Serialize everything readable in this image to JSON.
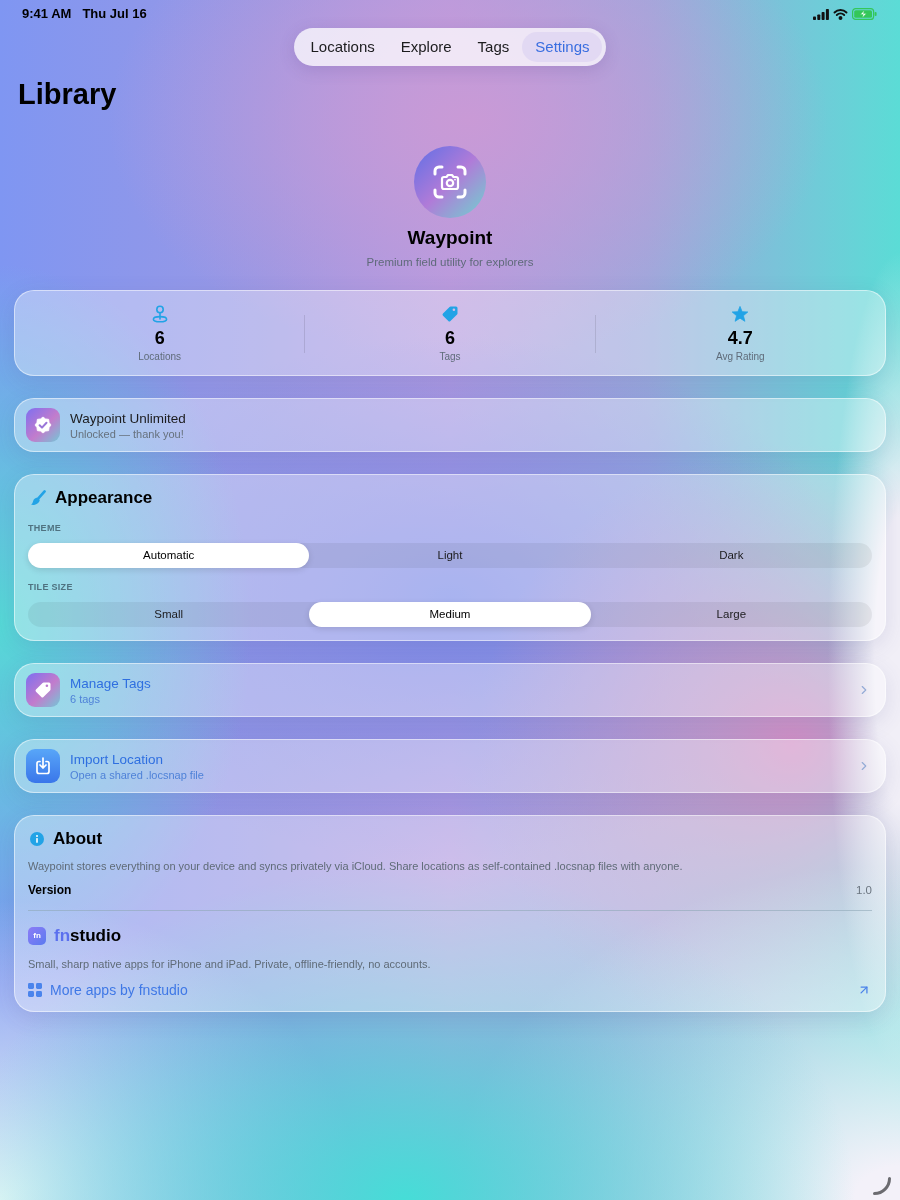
{
  "status_bar": {
    "time": "9:41 AM",
    "date": "Thu Jul 16"
  },
  "tabs": [
    {
      "label": "Locations",
      "selected": false
    },
    {
      "label": "Explore",
      "selected": false
    },
    {
      "label": "Tags",
      "selected": false
    },
    {
      "label": "Settings",
      "selected": true
    }
  ],
  "page_title": "Library",
  "app": {
    "name": "Waypoint",
    "tagline": "Premium field utility for explorers"
  },
  "stats": [
    {
      "kind": "pin",
      "value": "6",
      "label": "Locations"
    },
    {
      "kind": "tag",
      "value": "6",
      "label": "Tags"
    },
    {
      "kind": "star",
      "value": "4.7",
      "label": "Avg Rating"
    }
  ],
  "unlimited": {
    "title": "Waypoint Unlimited",
    "subtitle": "Unlocked — thank you!"
  },
  "appearance": {
    "title": "Appearance",
    "groups": [
      {
        "label": "THEME",
        "options": [
          {
            "label": "Automatic",
            "selected": true
          },
          {
            "label": "Light",
            "selected": false
          },
          {
            "label": "Dark",
            "selected": false
          }
        ]
      },
      {
        "label": "TILE SIZE",
        "options": [
          {
            "label": "Small",
            "selected": false
          },
          {
            "label": "Medium",
            "selected": true
          },
          {
            "label": "Large",
            "selected": false
          }
        ]
      }
    ]
  },
  "actions": [
    {
      "kind": "tags",
      "title": "Manage Tags",
      "subtitle": "6 tags"
    },
    {
      "kind": "import",
      "title": "Import Location",
      "subtitle": "Open a shared .locsnap file"
    }
  ],
  "about": {
    "title": "About",
    "description": "Waypoint stores everything on your device and syncs privately via iCloud. Share locations as self-contained .locsnap files with anyone.",
    "version_label": "Version",
    "version": "1.0",
    "studio": {
      "logo": "fn",
      "name_accent": "fn",
      "name_rest": "studio",
      "description": "Small, sharp native apps for iPhone and iPad. Private, offline-friendly, no accounts.",
      "link": "More apps by fnstudio"
    }
  }
}
